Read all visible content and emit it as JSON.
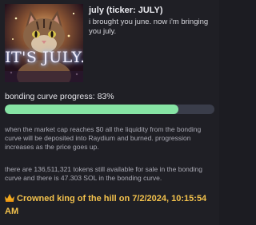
{
  "token": {
    "title": "july (ticker: JULY)",
    "description": "i brought you june. now i'm bringing you july.",
    "image_caption": "IT'S JULY."
  },
  "progress": {
    "label": "bonding curve progress: 83%",
    "percent": 83,
    "fill_color": "#86e3a4"
  },
  "info": {
    "market_cap_text": "when the market cap reaches $0 all the liquidity from the bonding curve will be deposited into Raydium and burned. progression increases as the price goes up.",
    "tokens_text": "there are 136,511,321 tokens still available for sale in the bonding curve and there is 47.303 SOL in the bonding curve."
  },
  "king": {
    "icon": "crown-icon",
    "text": "Crowned king of the hill on 7/2/2024, 10:15:54 AM",
    "color": "#f2c14c"
  }
}
